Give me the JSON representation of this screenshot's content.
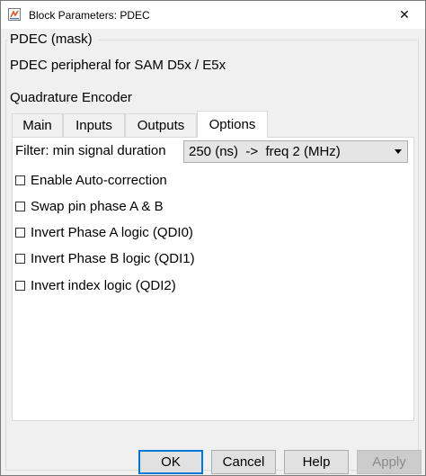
{
  "window": {
    "title": "Block Parameters: PDEC",
    "close_glyph": "✕"
  },
  "mask": {
    "title": "PDEC (mask)",
    "description": "PDEC peripheral for SAM D5x / E5x",
    "section": "Quadrature Encoder"
  },
  "tabs": [
    {
      "label": "Main",
      "active": false
    },
    {
      "label": "Inputs",
      "active": false
    },
    {
      "label": "Outputs",
      "active": false
    },
    {
      "label": "Options",
      "active": true
    }
  ],
  "options": {
    "filter_label": "Filter: min signal duration",
    "filter_value": "250 (ns)  ->  freq 2 (MHz)",
    "checkboxes": [
      {
        "label": "Enable Auto-correction",
        "checked": false
      },
      {
        "label": "Swap pin phase A & B",
        "checked": false
      },
      {
        "label": "Invert Phase A logic (QDI0)",
        "checked": false
      },
      {
        "label": "Invert Phase B logic (QDI1)",
        "checked": false
      },
      {
        "label": "Invert index logic (QDI2)",
        "checked": false
      }
    ]
  },
  "buttons": {
    "ok": "OK",
    "cancel": "Cancel",
    "help": "Help",
    "apply": "Apply"
  },
  "colors": {
    "default_button_border": "#0078d7",
    "icon_red": "#d9531e",
    "icon_blue": "#3c6eb4"
  },
  "icons": {
    "app": "simulink-block-icon",
    "close": "close-icon",
    "dropdown": "chevron-down-icon"
  }
}
